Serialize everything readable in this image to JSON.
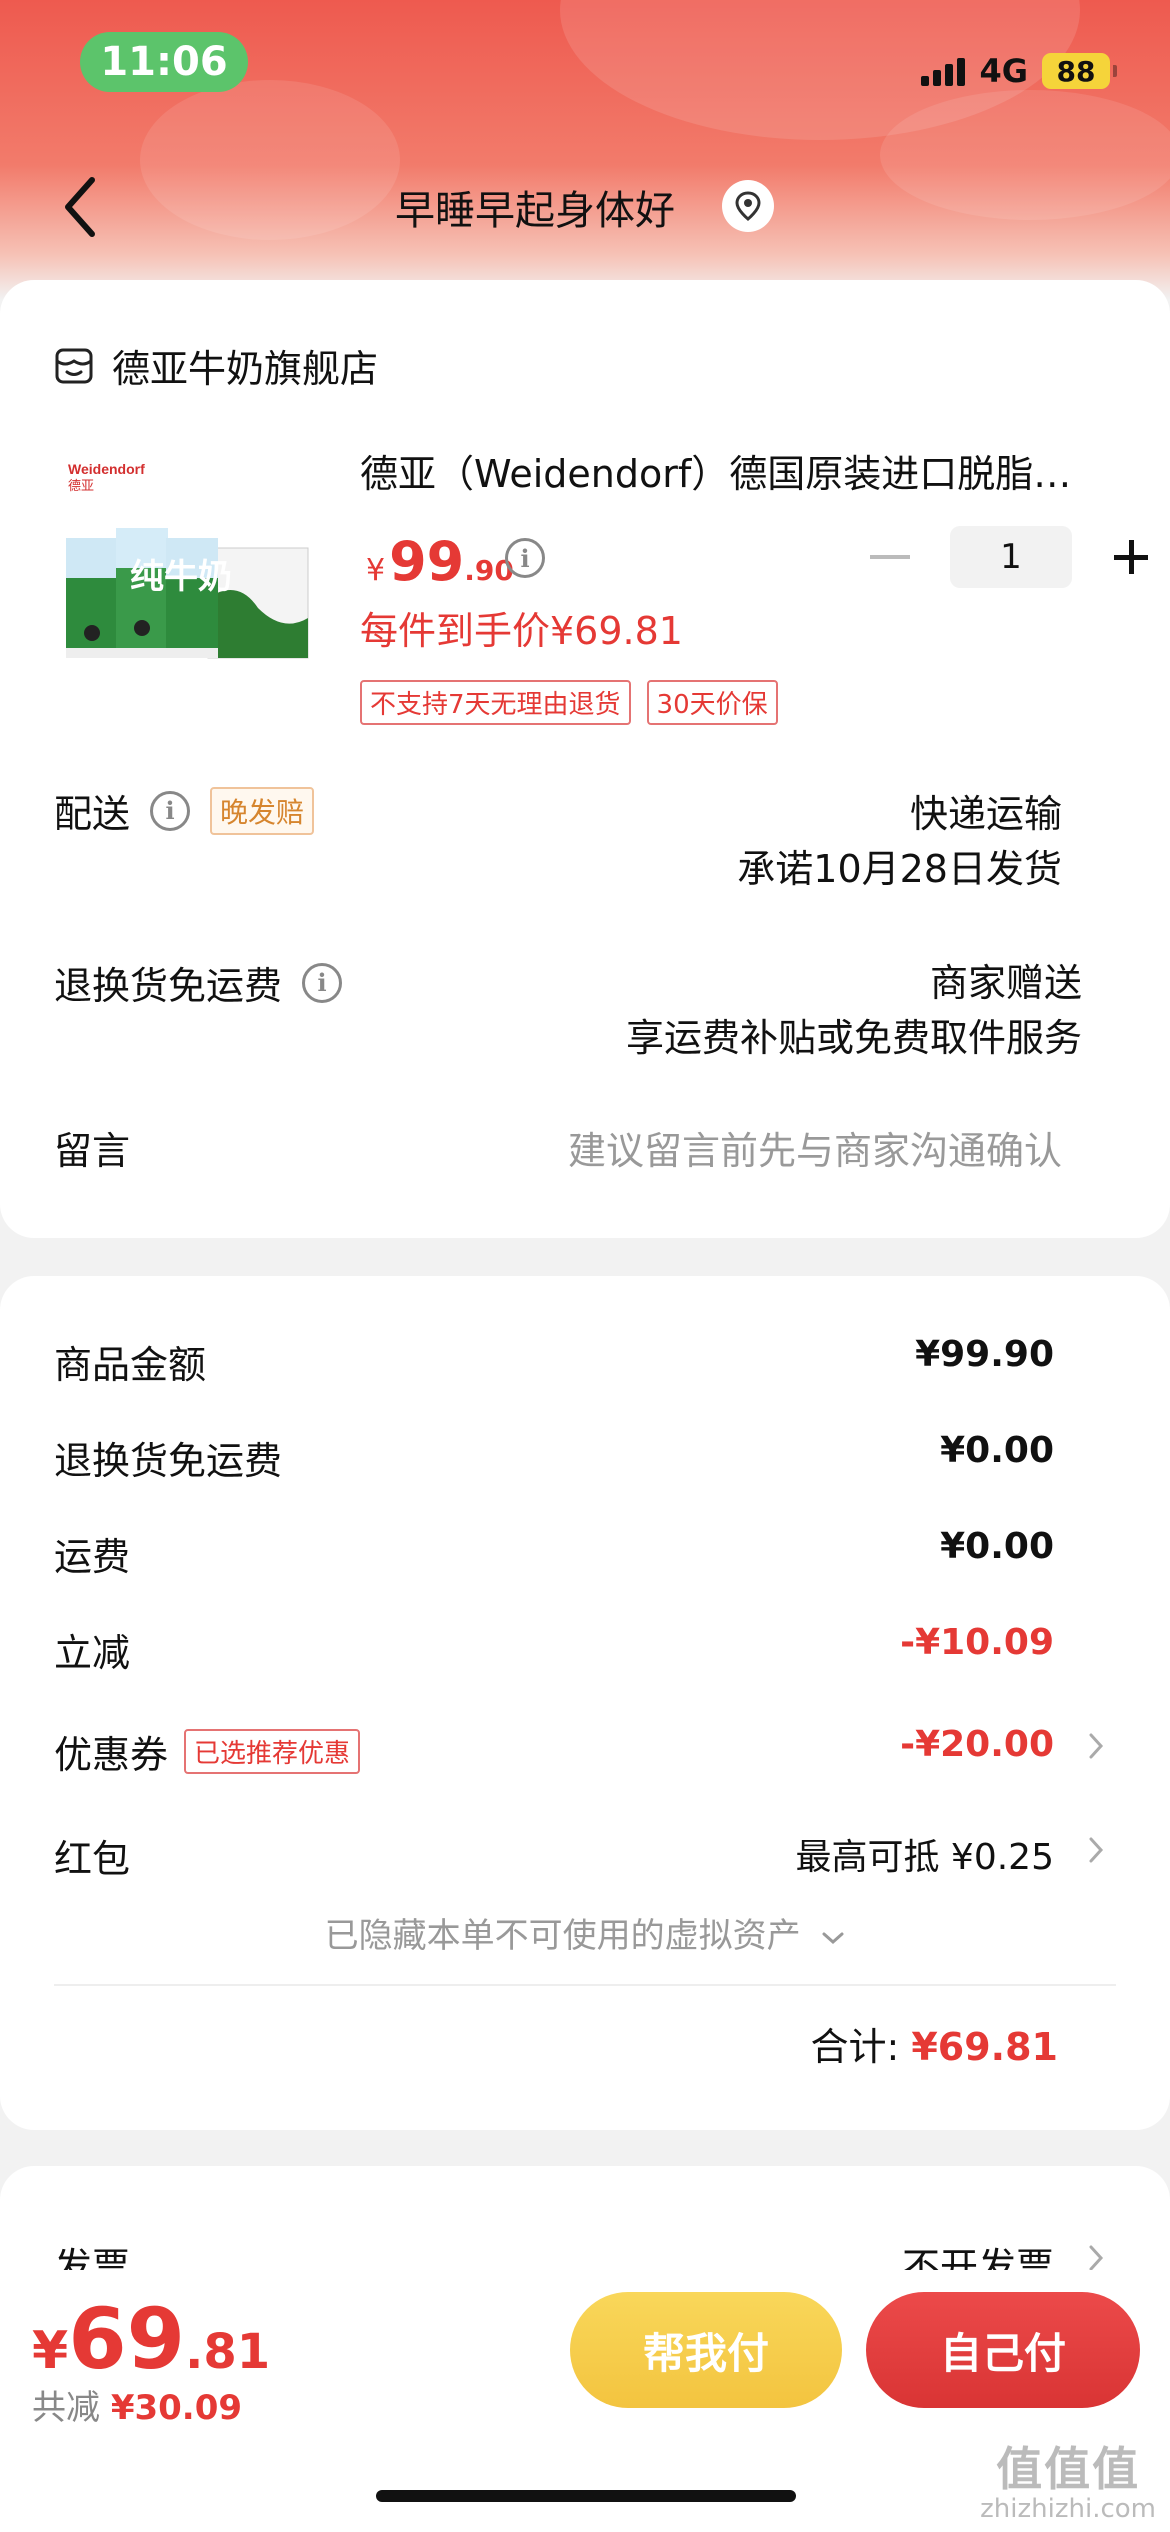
{
  "status_bar": {
    "time": "11:06",
    "network": "4G",
    "battery": "88"
  },
  "nav": {
    "title": "早睡早起身体好"
  },
  "store": {
    "name": "德亚牛奶旗舰店",
    "product": {
      "title": "德亚（Weidendorf）德国原装进口脱脂…",
      "price_symbol": "¥",
      "price_int": "99",
      "price_dec": ".90",
      "unit_price": "每件到手价¥69.81",
      "quantity": "1",
      "tags": [
        "不支持7天无理由退货",
        "30天价保"
      ],
      "image_brand": "Weidendorf",
      "image_brand_cn": "德亚",
      "image_pack_text": "纯牛奶"
    },
    "delivery": {
      "label": "配送",
      "badge": "晚发赔",
      "method": "快递运输",
      "promise": "承诺10月28日发货"
    },
    "return_shipping": {
      "label": "退换货免运费",
      "value1": "商家赠送",
      "value2": "享运费补贴或免费取件服务"
    },
    "message": {
      "label": "留言",
      "placeholder": "建议留言前先与商家沟通确认"
    }
  },
  "summary": {
    "rows": [
      {
        "label": "商品金额",
        "value": "¥99.90"
      },
      {
        "label": "退换货免运费",
        "value": "¥0.00"
      },
      {
        "label": "运费",
        "value": "¥0.00"
      },
      {
        "label": "立减",
        "value": "-¥10.09"
      },
      {
        "label": "优惠券",
        "badge": "已选推荐优惠",
        "value": "-¥20.00"
      },
      {
        "label": "红包",
        "value": "最高可抵 ¥0.25"
      }
    ],
    "hidden_assets": "已隐藏本单不可使用的虚拟资产",
    "total_label": "合计:",
    "total_value": "¥69.81"
  },
  "invoice": {
    "label": "发票",
    "value": "不开发票"
  },
  "bottom": {
    "yen": "¥",
    "total_int": "69",
    "total_dec": ".81",
    "discount_label": "共减",
    "discount_value": "¥30.09",
    "help_pay": "帮我付",
    "self_pay": "自己付"
  },
  "watermark": {
    "line1": "值值值",
    "line2": "zhizhizhi.com"
  },
  "colors": {
    "accent_red": "#e53935",
    "header": "#ee5a4f",
    "help_button": "#f3c43f"
  }
}
